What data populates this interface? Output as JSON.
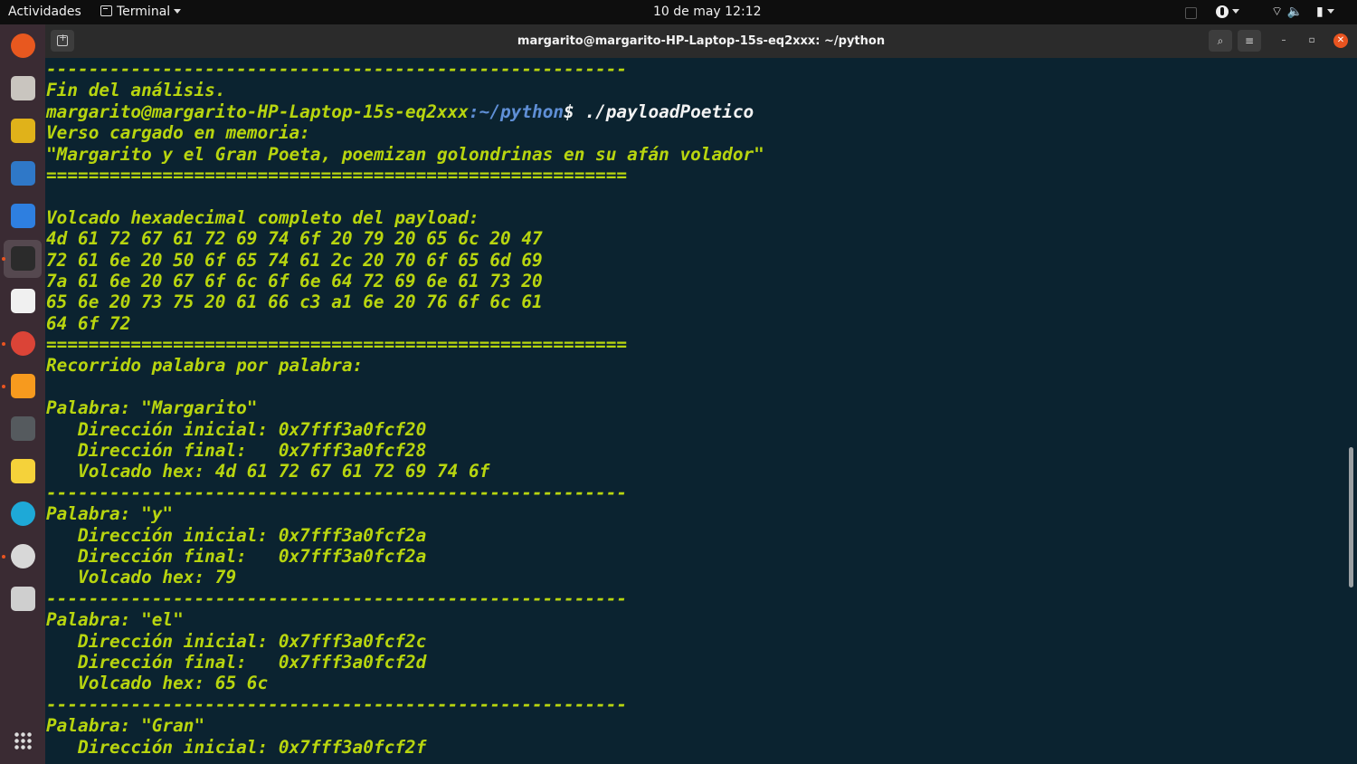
{
  "topbar": {
    "activities": "Actividades",
    "app_name": "Terminal",
    "clock": "10 de may  12:12"
  },
  "dock": {
    "items": [
      {
        "name": "firefox-icon",
        "color": "#e8581f",
        "active": false,
        "running": false
      },
      {
        "name": "files-icon",
        "color": "#c9c5bf",
        "active": false,
        "running": false
      },
      {
        "name": "rhythmbox-icon",
        "color": "#e0b21a",
        "active": false,
        "running": false
      },
      {
        "name": "writer-icon",
        "color": "#2f78c8",
        "active": false,
        "running": false
      },
      {
        "name": "vscode-icon",
        "color": "#2e7fe0",
        "active": false,
        "running": false
      },
      {
        "name": "terminal-icon",
        "color": "#2b2b2b",
        "active": true,
        "running": true
      },
      {
        "name": "virtualbox-icon",
        "color": "#f0f0f0",
        "active": false,
        "running": false
      },
      {
        "name": "chrome-icon",
        "color": "#db4437",
        "active": false,
        "running": true
      },
      {
        "name": "sublime-icon",
        "color": "#f79a1e",
        "active": false,
        "running": true
      },
      {
        "name": "calculator-icon",
        "color": "#555a5e",
        "active": false,
        "running": false
      },
      {
        "name": "text-editor-icon",
        "color": "#f5d23a",
        "active": false,
        "running": false
      },
      {
        "name": "edge-icon",
        "color": "#1ea9d7",
        "active": false,
        "running": false
      },
      {
        "name": "settings-icon",
        "color": "#d8d8d8",
        "active": false,
        "running": true
      },
      {
        "name": "usb-drive-icon",
        "color": "#cfcfcf",
        "active": false,
        "running": false
      }
    ],
    "apps_grid_icon": "apps-grid-icon"
  },
  "window": {
    "title": "margarito@margarito-HP-Laptop-15s-eq2xxx: ~/python"
  },
  "terminal": {
    "prompt_user": "margarito@margarito-HP-Laptop-15s-eq2xxx",
    "prompt_path": ":~/python",
    "prompt_symbol": "$ ",
    "command": "./payloadPoetico",
    "lines": [
      "-------------------------------------------------------",
      "Fin del análisis.",
      "__PROMPT__",
      "Verso cargado en memoria:",
      "\"Margarito y el Gran Poeta, poemizan golondrinas en su afán volador\"",
      "=======================================================",
      "",
      "Volcado hexadecimal completo del payload:",
      "4d 61 72 67 61 72 69 74 6f 20 79 20 65 6c 20 47",
      "72 61 6e 20 50 6f 65 74 61 2c 20 70 6f 65 6d 69",
      "7a 61 6e 20 67 6f 6c 6f 6e 64 72 69 6e 61 73 20",
      "65 6e 20 73 75 20 61 66 c3 a1 6e 20 76 6f 6c 61",
      "64 6f 72",
      "=======================================================",
      "Recorrido palabra por palabra:",
      "",
      "Palabra: \"Margarito\"",
      "   Dirección inicial: 0x7fff3a0fcf20",
      "   Dirección final:   0x7fff3a0fcf28",
      "   Volcado hex: 4d 61 72 67 61 72 69 74 6f",
      "-------------------------------------------------------",
      "Palabra: \"y\"",
      "   Dirección inicial: 0x7fff3a0fcf2a",
      "   Dirección final:   0x7fff3a0fcf2a",
      "   Volcado hex: 79",
      "-------------------------------------------------------",
      "Palabra: \"el\"",
      "   Dirección inicial: 0x7fff3a0fcf2c",
      "   Dirección final:   0x7fff3a0fcf2d",
      "   Volcado hex: 65 6c",
      "-------------------------------------------------------",
      "Palabra: \"Gran\"",
      "   Dirección inicial: 0x7fff3a0fcf2f"
    ]
  },
  "colors": {
    "terminal_bg": "#0b2330",
    "terminal_text": "#b8d50f",
    "prompt_path": "#5f8fd6",
    "accent": "#e95420"
  }
}
